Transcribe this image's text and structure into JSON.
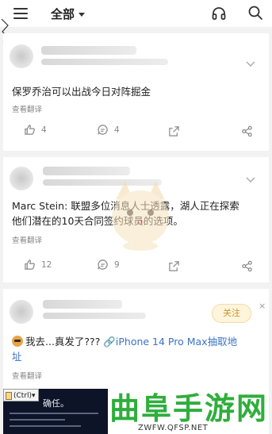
{
  "header": {
    "tab_label": "全部",
    "icons": [
      "menu-icon",
      "chevron-down-icon",
      "headphone-icon",
      "search-icon"
    ]
  },
  "posts": [
    {
      "text": "保罗乔治可以出战今日对阵掘金",
      "translate_label": "查看翻译",
      "likes": "4",
      "comments": "4"
    },
    {
      "text_line1": "Marc Stein: 联盟多位消息人士透露，湖人正在探索",
      "text_line2": "他们潜在的10天合同签约球员的选项。",
      "translate_label": "查看翻译",
      "likes": "12",
      "comments": "9"
    },
    {
      "text_prefix": "我去...真发了???",
      "link_text_line1": "iPhone 14 Pro Max抽取地",
      "link_text_line2": "址",
      "translate_label": "查看翻译",
      "follow_label": "关注",
      "close_label": "×",
      "thumbnail_title": "确任。"
    }
  ],
  "paste": {
    "label": "(Ctrl)▾"
  },
  "watermark": {
    "title": "曲阜手游网",
    "url": "ZWFW.QFSP.NET"
  },
  "colors": {
    "accent_follow": "#c9922b",
    "link": "#3b73c4",
    "watermark_green": "#2fae3c"
  }
}
